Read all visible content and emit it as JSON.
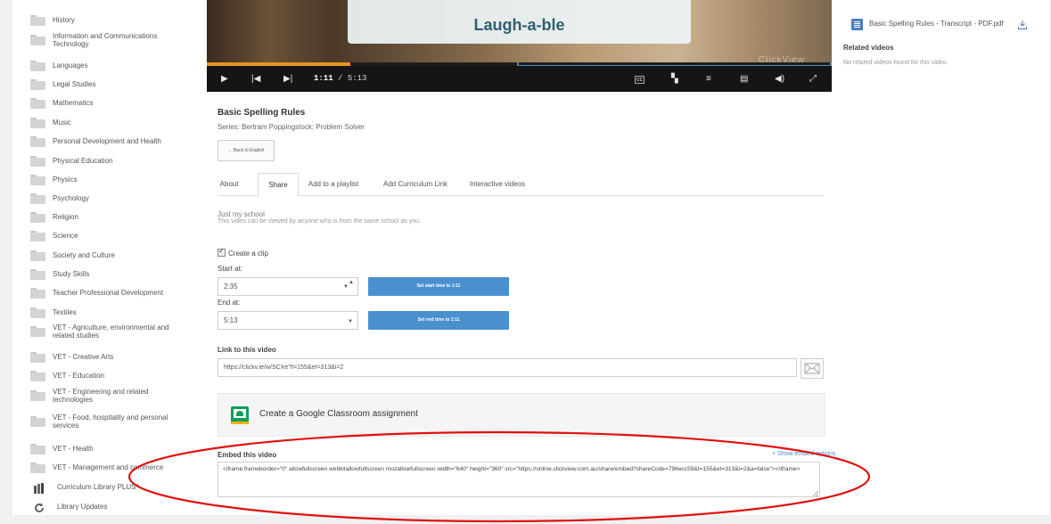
{
  "sidebar": {
    "categories": [
      {
        "label": "History"
      },
      {
        "label": "Information and Communications Technology"
      },
      {
        "label": "Languages"
      },
      {
        "label": "Legal Studies"
      },
      {
        "label": "Mathematics"
      },
      {
        "label": "Music"
      },
      {
        "label": "Personal Development and Health"
      },
      {
        "label": "Physical Education"
      },
      {
        "label": "Physics"
      },
      {
        "label": "Psychology"
      },
      {
        "label": "Religion"
      },
      {
        "label": "Science"
      },
      {
        "label": "Society and Culture"
      },
      {
        "label": "Study Skills"
      },
      {
        "label": "Teacher Professional Development"
      },
      {
        "label": "Textiles"
      },
      {
        "label": "VET - Agriculture, environmental and related studies"
      },
      {
        "label": "VET - Creative Arts"
      },
      {
        "label": "VET - Education"
      },
      {
        "label": "VET - Engineering and related technologies"
      },
      {
        "label": "VET - Food, hospitality and personal services"
      },
      {
        "label": "VET - Health"
      },
      {
        "label": "VET - Management and commerce"
      }
    ],
    "curriculum_library": "Curriculum Library PLUS*",
    "library_updates": "Library Updates"
  },
  "video": {
    "on_screen_title": "Laugh-a-ble",
    "watermark": "ClickView",
    "current_time": "1:11",
    "duration": "/ 5:13",
    "progress_fraction": 0.23
  },
  "info": {
    "title": "Basic Spelling Rules",
    "series": "Series: Bertram Poppingstock: Problem Solver",
    "back_button": "← Back to English"
  },
  "tabs": [
    {
      "label": "About",
      "active": false
    },
    {
      "label": "Share",
      "active": true
    },
    {
      "label": "Add to a playlist",
      "active": false
    },
    {
      "label": "Add Curriculum Link",
      "active": false
    },
    {
      "label": "Interactive videos",
      "active": false
    }
  ],
  "share": {
    "privacy_heading": "Just my school",
    "privacy_desc": "This video can be viewed by anyone who is from the same school as you.",
    "create_clip": "Create a clip",
    "start_label": "Start at:",
    "start_value": "2:35",
    "start_button": "Set start time to 1:11",
    "end_label": "End at:",
    "end_value": "5:13",
    "end_button": "Set end time to 1:11",
    "link_label": "Link to this video",
    "link_value": "https://clickv.ie/w/SCXe?t=155&et=313&i=2",
    "google_classroom": "Create a Google Classroom assignment",
    "embed_label": "Embed this video",
    "show_embed_options": "+ Show embed options",
    "embed_code": "<iframe frameborder=\"0\" allowfullscreen webkitallowfullscreen mozallowfullscreen width=\"640\" height=\"360\" src=\"https://online.clickview.com.au/share/embed?shareCode=796ecc59&t=155&et=313&i=2&a=false\"></iframe>"
  },
  "right_panel": {
    "transcript": "Basic Spelling Rules - Transcript - PDF.pdf",
    "related_heading": "Related videos",
    "related_none": "No related videos found for this video."
  },
  "colors": {
    "accent_blue": "#4a90cf",
    "progress_orange": "#e8931e",
    "annotation_red": "#e01010",
    "google_green": "#0f9d58"
  }
}
